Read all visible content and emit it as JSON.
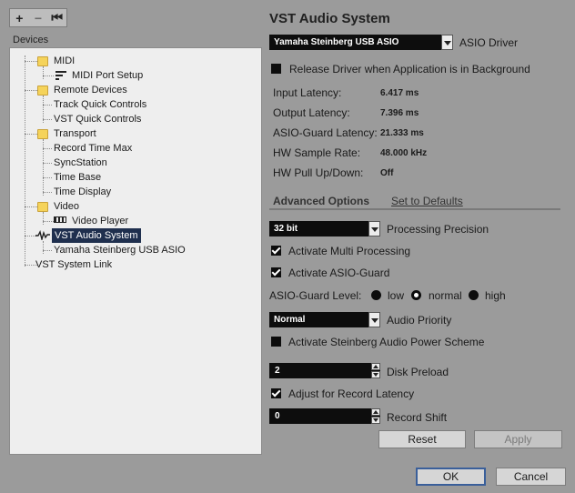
{
  "toolbar": {
    "add": "+",
    "remove": "−",
    "reset": "⏮"
  },
  "devices_label": "Devices",
  "tree": {
    "midi": "MIDI",
    "midi_port_setup": "MIDI Port Setup",
    "remote_devices": "Remote Devices",
    "track_quick_controls": "Track Quick Controls",
    "vst_quick_controls": "VST Quick Controls",
    "transport": "Transport",
    "record_time_max": "Record Time Max",
    "syncstation": "SyncStation",
    "time_base": "Time Base",
    "time_display": "Time Display",
    "video": "Video",
    "video_player": "Video Player",
    "vst_audio_system": "VST Audio System",
    "yamaha_usb_asio": "Yamaha Steinberg USB ASIO",
    "vst_system_link": "VST System Link"
  },
  "panel": {
    "title": "VST Audio System",
    "asio_driver_value": "Yamaha Steinberg USB ASIO",
    "asio_driver_label": "ASIO Driver",
    "release_driver": "Release Driver when Application is in Background",
    "input_latency_label": "Input Latency:",
    "input_latency": "6.417 ms",
    "output_latency_label": "Output Latency:",
    "output_latency": "7.396 ms",
    "asio_guard_latency_label": "ASIO-Guard Latency:",
    "asio_guard_latency": "21.333 ms",
    "hw_sample_rate_label": "HW Sample Rate:",
    "hw_sample_rate": "48.000 kHz",
    "hw_pull_label": "HW Pull Up/Down:",
    "hw_pull": "Off",
    "advanced_options": "Advanced Options",
    "set_to_defaults": "Set to Defaults",
    "precision_value": "32 bit",
    "precision_label": "Processing Precision",
    "multi_processing": "Activate Multi Processing",
    "asio_guard": "Activate ASIO-Guard",
    "asio_guard_level_label": "ASIO-Guard Level:",
    "level_low": "low",
    "level_normal": "normal",
    "level_high": "high",
    "audio_priority_value": "Normal",
    "audio_priority_label": "Audio Priority",
    "power_scheme": "Activate Steinberg Audio Power Scheme",
    "disk_preload_value": "2",
    "disk_preload_label": "Disk Preload",
    "adjust_record_latency": "Adjust for Record Latency",
    "record_shift_value": "0",
    "record_shift_label": "Record Shift",
    "reset": "Reset",
    "apply": "Apply"
  },
  "dialog": {
    "ok": "OK",
    "cancel": "Cancel"
  },
  "state": {
    "release_driver_checked": false,
    "multi_processing_checked": true,
    "asio_guard_checked": true,
    "power_scheme_checked": false,
    "adjust_record_latency_checked": true,
    "asio_guard_level_selected": "normal"
  }
}
